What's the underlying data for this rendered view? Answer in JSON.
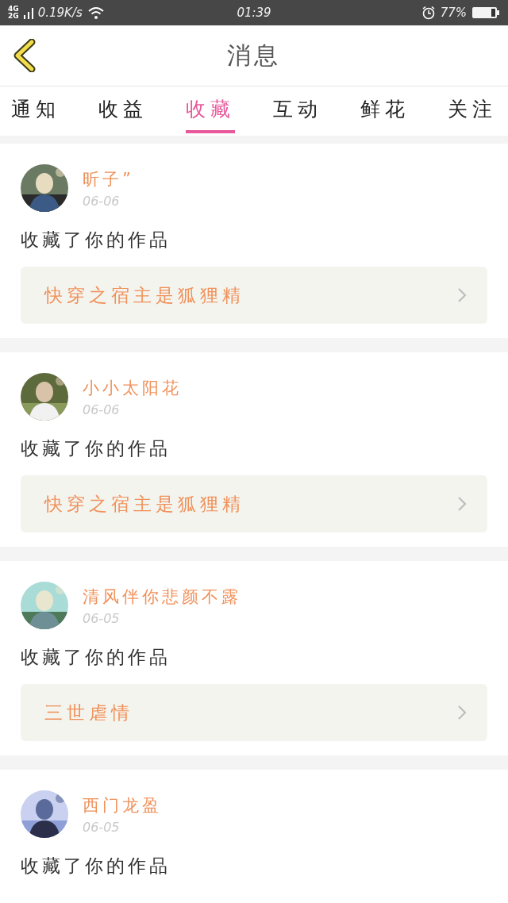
{
  "status_bar": {
    "network": [
      "4G",
      "2G"
    ],
    "speed": "0.19K/s",
    "time": "01:39",
    "battery": "77%"
  },
  "header": {
    "title": "消息"
  },
  "tabs": [
    {
      "label": "通知",
      "selected": false
    },
    {
      "label": "收益",
      "selected": false
    },
    {
      "label": "收藏",
      "selected": true
    },
    {
      "label": "互动",
      "selected": false
    },
    {
      "label": "鲜花",
      "selected": false
    },
    {
      "label": "关注",
      "selected": false
    }
  ],
  "messages": [
    {
      "name": "昕子”",
      "date": "06-06",
      "action": "收藏了你的作品",
      "work": "快穿之宿主是狐狸精"
    },
    {
      "name": "小小太阳花",
      "date": "06-06",
      "action": "收藏了你的作品",
      "work": "快穿之宿主是狐狸精"
    },
    {
      "name": "清风伴你悲颜不露",
      "date": "06-05",
      "action": "收藏了你的作品",
      "work": "三世虐情"
    },
    {
      "name": "西门龙盈",
      "date": "06-05",
      "action": "收藏了你的作品"
    }
  ]
}
